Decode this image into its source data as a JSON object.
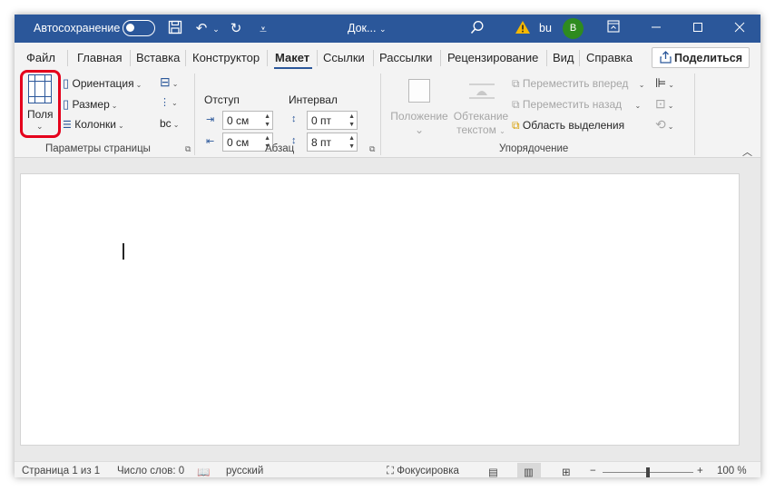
{
  "titlebar": {
    "autosave_label": "Автосохранение",
    "doc_title": "Док...",
    "doc_title_caret": "⌄",
    "user_name": "bu",
    "avatar_letter": "B",
    "colors": {
      "bar": "#2b579a",
      "avatar": "#2e8b1f",
      "warning": "#f5b800"
    }
  },
  "tabs": [
    "Файл",
    "Главная",
    "Вставка",
    "Конструктор",
    "Макет",
    "Ссылки",
    "Рассылки",
    "Рецензирование",
    "Вид",
    "Справка"
  ],
  "active_tab": "Макет",
  "share_label": "Поделиться",
  "page_setup": {
    "fields_label": "Поля",
    "orientation_label": "Ориентация",
    "size_label": "Размер",
    "columns_label": "Колонки",
    "group_label": "Параметры страницы",
    "hyphen_glyph": "bc"
  },
  "paragraph": {
    "indent_label": "Отступ",
    "spacing_label": "Интервал",
    "indent_left": "0 см",
    "indent_right": "0 см",
    "spacing_before": "0 пт",
    "spacing_after": "8 пт",
    "group_label": "Абзац"
  },
  "arrange": {
    "position_label_1": "Положение",
    "wrap_label_1": "Обтекание",
    "wrap_label_2": "текстом",
    "forward_label": "Переместить вперед",
    "backward_label": "Переместить назад",
    "selection_pane_label": "Область выделения",
    "group_label": "Упорядочение"
  },
  "status": {
    "page": "Страница 1 из 1",
    "words": "Число слов: 0",
    "language": "русский",
    "focus": "Фокусировка",
    "zoom_minus": "−",
    "zoom_plus": "+",
    "zoom": "100 %"
  }
}
